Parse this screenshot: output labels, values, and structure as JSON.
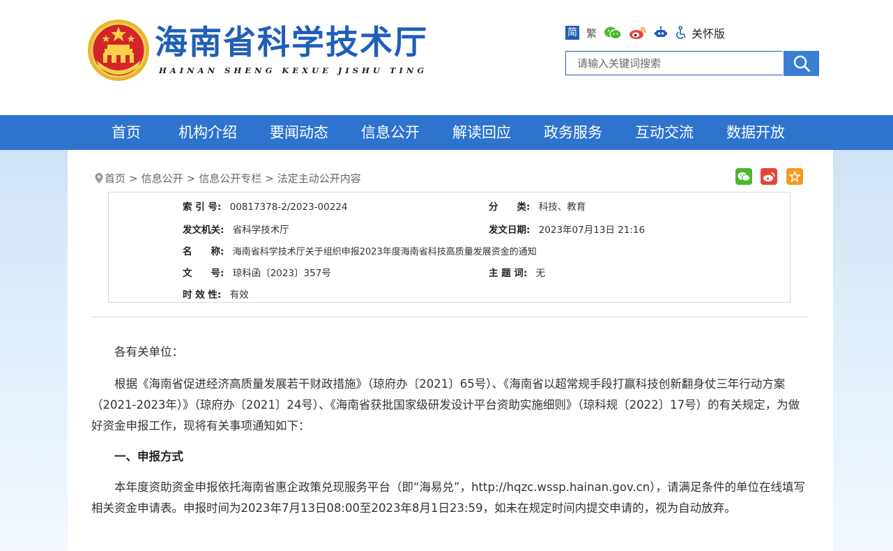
{
  "site": {
    "title": "海南省科学技术厅",
    "pinyin": "HAINAN SHENG KEXUE JISHU TING"
  },
  "toolbar": {
    "simplified": "简",
    "traditional": "繁",
    "care_mode": "关怀版"
  },
  "search": {
    "placeholder": "请输入关键词搜索"
  },
  "nav": {
    "items": [
      "首页",
      "机构介绍",
      "要闻动态",
      "信息公开",
      "解读回应",
      "政务服务",
      "互动交流",
      "数据开放"
    ]
  },
  "breadcrumb": {
    "items": [
      "首页",
      "信息公开",
      "信息公开专栏",
      "法定主动公开内容"
    ],
    "separator": ">"
  },
  "meta": {
    "index_label": "索 引 号:",
    "index_value": "00817378-2/2023-00224",
    "category_label": "分　　类:",
    "category_value": "科技、教育",
    "issuer_label": "发文机关:",
    "issuer_value": "省科学技术厅",
    "date_label": "发文日期:",
    "date_value": "2023年07月13日 21:16",
    "name_label": "名　　称:",
    "name_value": "海南省科学技术厅关于组织申报2023年度海南省科技高质量发展资金的通知",
    "docno_label": "文　　号:",
    "docno_value": "琼科函〔2023〕357号",
    "keywords_label": "主 题 词:",
    "keywords_value": "无",
    "validity_label": "时 效 性:",
    "validity_value": "有效"
  },
  "article": {
    "greeting": "各有关单位：",
    "p1": "根据《海南省促进经济高质量发展若干财政措施》（琼府办〔2021〕65号）、《海南省以超常规手段打赢科技创新翻身仗三年行动方案（2021-2023年）》（琼府办〔2021〕24号）、《海南省获批国家级研发设计平台资助实施细则》（琼科规〔2022〕17号）的有关规定，为做好资金申报工作，现将有关事项通知如下：",
    "h1": "一、申报方式",
    "p2": "本年度资助资金申报依托海南省惠企政策兑现服务平台（即“海易兑”，http://hqzc.wssp.hainan.gov.cn），请满足条件的单位在线填写相关资金申请表。申报时间为2023年7月13日08:00至2023年8月1日23:59，如未在规定时间内提交申请的，视为自动放弃。"
  },
  "colors": {
    "brand_blue": "#1f5fb8",
    "nav_blue": "#2e74cf",
    "search_button": "#3b7fd4",
    "wechat_green": "#4cb82e",
    "weibo_red": "#e6463a",
    "favorite_orange": "#f39a1f"
  }
}
